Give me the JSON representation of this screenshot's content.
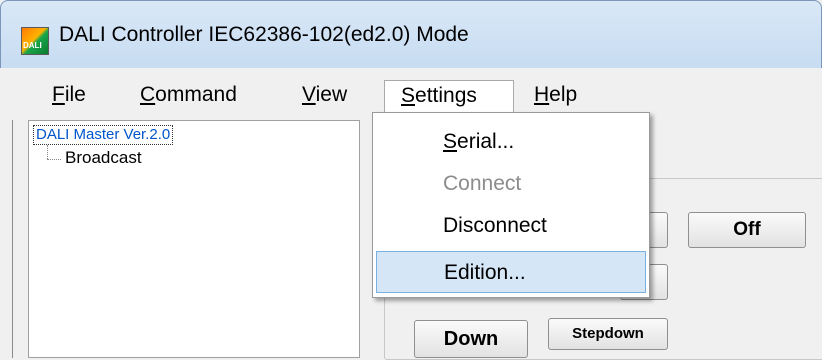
{
  "window": {
    "title": "DALI Controller IEC62386-102(ed2.0) Mode",
    "icon_label": "DALI"
  },
  "menubar": {
    "file": {
      "mnemonic": "F",
      "rest": "ile"
    },
    "command": {
      "mnemonic": "C",
      "rest": "ommand"
    },
    "view": {
      "mnemonic": "V",
      "rest": "iew"
    },
    "settings": {
      "mnemonic": "S",
      "rest": "ettings"
    },
    "help": {
      "mnemonic": "H",
      "rest": "elp"
    }
  },
  "tree": {
    "root": "DALI Master Ver.2.0",
    "child": "Broadcast"
  },
  "settings_menu": {
    "serial": {
      "mnemonic": "S",
      "rest": "erial..."
    },
    "connect": "Connect",
    "disconnect": "Disconnect",
    "edition": "Edition..."
  },
  "buttons": {
    "off": "Off",
    "down": "Down",
    "stepdown": "Stepdown"
  },
  "colors": {
    "selection_highlight": "#d5e6f7",
    "tree_root_text": "#0055cc"
  }
}
